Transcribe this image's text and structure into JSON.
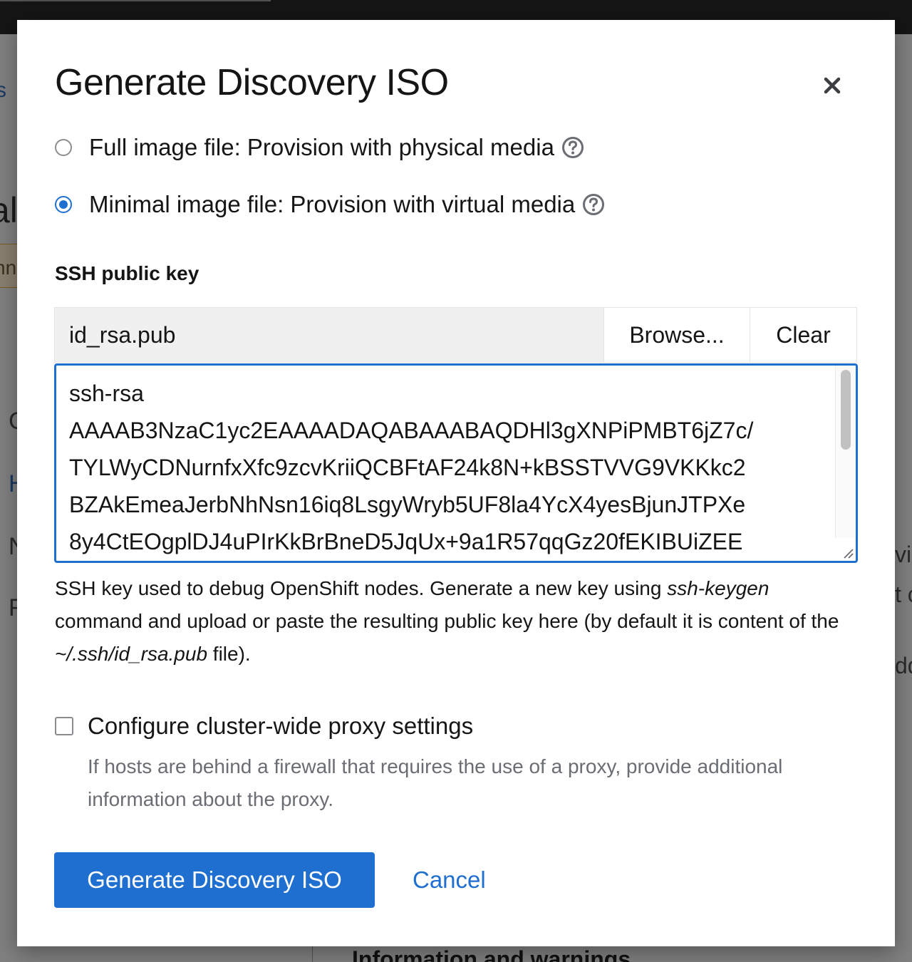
{
  "modal": {
    "title": "Generate Discovery ISO",
    "close_icon": "close-icon"
  },
  "image_type": {
    "options": [
      {
        "label": "Full image file: Provision with physical media",
        "selected": false,
        "help_icon": "help-icon"
      },
      {
        "label": "Minimal image file: Provision with virtual media",
        "selected": true,
        "help_icon": "help-icon"
      }
    ]
  },
  "ssh": {
    "label": "SSH public key",
    "file_name": "id_rsa.pub",
    "browse_label": "Browse...",
    "clear_label": "Clear",
    "key_lines": [
      "ssh-rsa",
      "AAAAB3NzaC1yc2EAAAADAQABAAABAQDHl3gXNPiPMBT6jZ7c/",
      "TYLWyCDNurnfxXfc9zcvKriiQCBFtAF24k8N+kBSSTVVG9VKKkc2",
      "BZAkEmeaJerbNhNsn16iq8LsgyWryb5UF8la4YcX4yesBjunJTPXe",
      "8y4CtEOgplDJ4uPIrKkBrBneD5JqUx+9a1R57qqGz20fEKIBUiZEE"
    ],
    "helper_part1": "SSH key used to debug OpenShift nodes. Generate a new key using ",
    "helper_cmd": "ssh-keygen",
    "helper_part2": " command and upload or paste the resulting public key here (by default it is content of the ",
    "helper_path": "~/.ssh/id_rsa.pub",
    "helper_part3": " file)."
  },
  "proxy": {
    "label": "Configure cluster-wide proxy settings",
    "checked": false,
    "description": "If hosts are behind a firewall that requires the use of a proxy, provide additional information about the proxy."
  },
  "actions": {
    "primary_label": "Generate Discovery ISO",
    "cancel_label": "Cancel"
  },
  "background": {
    "fragments": [
      "s",
      "all",
      "nn",
      "C",
      "H",
      "N",
      "F",
      "vic",
      "t c",
      "dd"
    ],
    "heading": "Information and warnings"
  },
  "colors": {
    "accent": "#1f6fd1",
    "text": "#151515",
    "muted": "#6a6e73"
  }
}
